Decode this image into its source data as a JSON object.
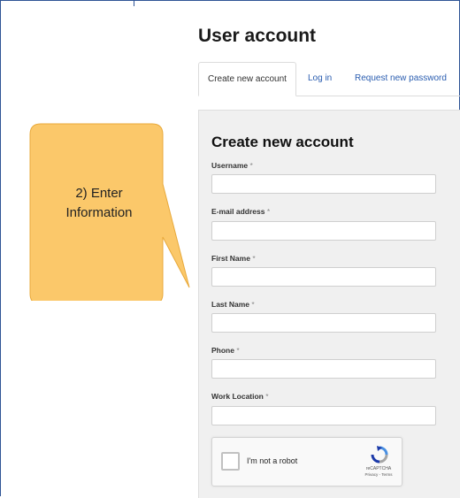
{
  "page": {
    "title": "User account"
  },
  "tabs": [
    {
      "label": "Create new account",
      "active": true
    },
    {
      "label": "Log in",
      "active": false
    },
    {
      "label": "Request new password",
      "active": false
    }
  ],
  "form": {
    "title": "Create new account",
    "required_marker": "*",
    "fields": [
      {
        "label": "Username",
        "value": ""
      },
      {
        "label": "E-mail address",
        "value": ""
      },
      {
        "label": "First Name",
        "value": ""
      },
      {
        "label": "Last Name",
        "value": ""
      },
      {
        "label": "Phone",
        "value": ""
      },
      {
        "label": "Work Location",
        "value": ""
      }
    ]
  },
  "captcha": {
    "label": "I'm not a robot",
    "brand": "reCAPTCHA",
    "links": "Privacy - Terms",
    "checked": false
  },
  "callout": {
    "line1": "2) Enter",
    "line2": "Information",
    "fill_color": "#fbc86a",
    "border_color": "#e8a93a"
  },
  "colors": {
    "frame_border": "#2f5496",
    "link": "#2a5db0",
    "panel_bg": "#f0f0f0"
  }
}
